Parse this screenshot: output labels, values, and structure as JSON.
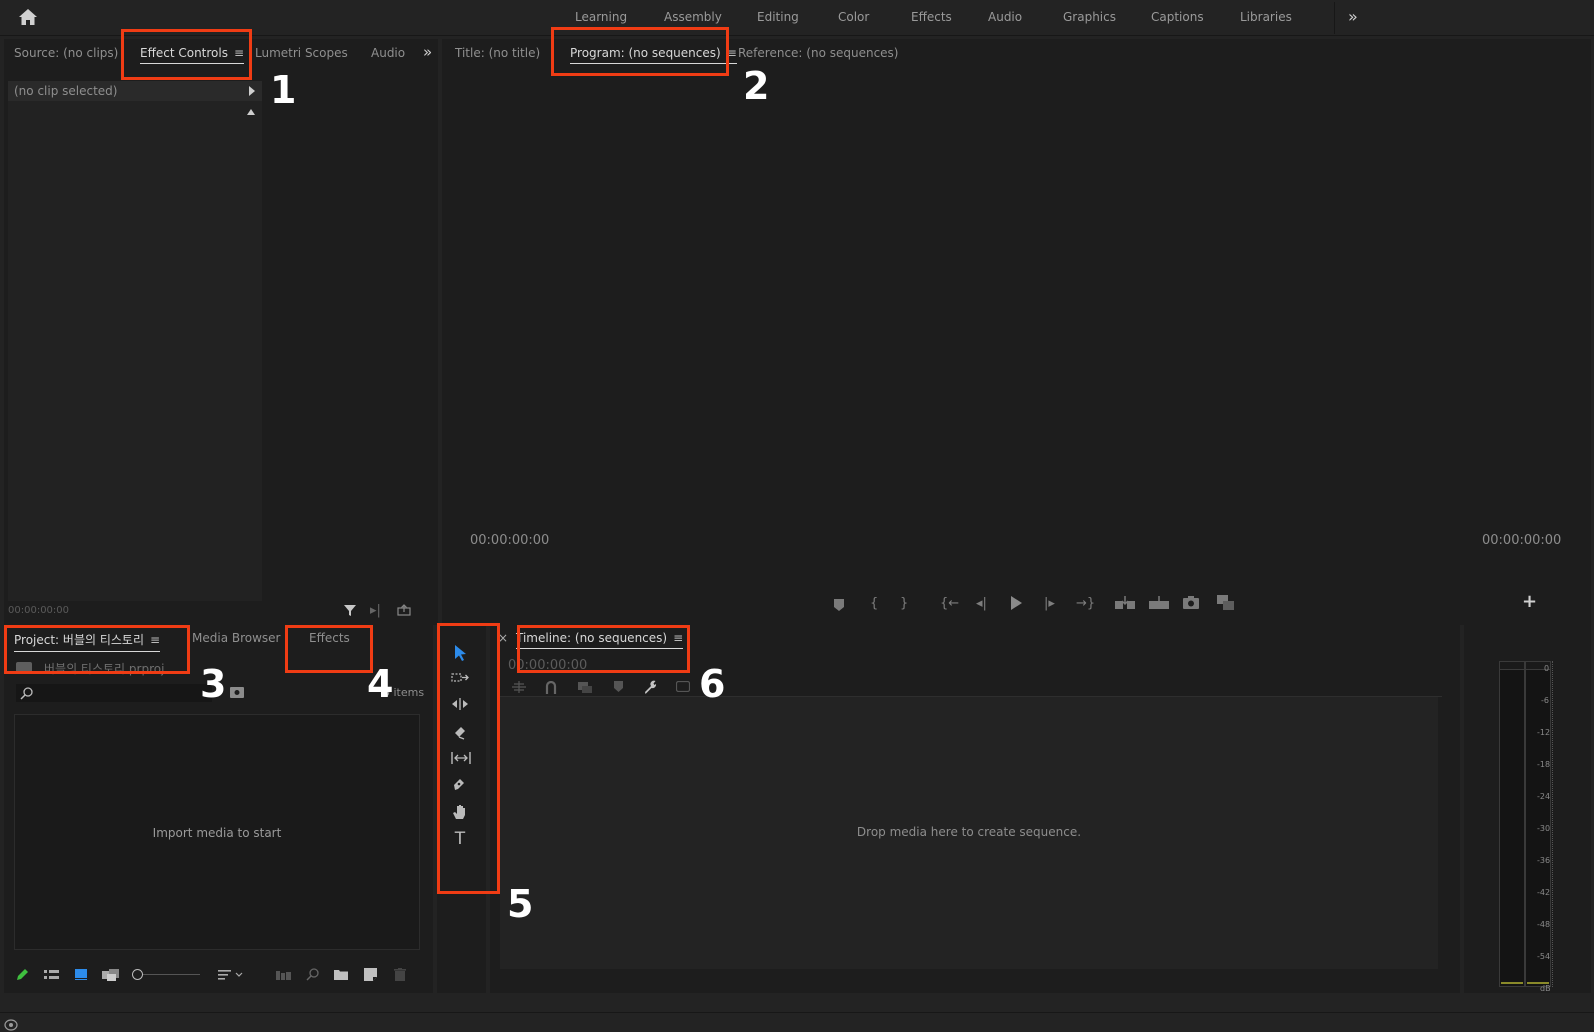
{
  "workspaces": {
    "home_icon": "home-icon",
    "items": [
      "Learning",
      "Assembly",
      "Editing",
      "Color",
      "Effects",
      "Audio",
      "Graphics",
      "Captions",
      "Libraries"
    ],
    "overflow_icon": "»"
  },
  "source_panel": {
    "tabs": {
      "source": "Source: (no clips)",
      "effect_controls": "Effect Controls",
      "lumetri": "Lumetri Scopes",
      "audio": "Audio",
      "overflow": "»"
    },
    "hamburger": "≡",
    "clip_header": "(no clip selected)",
    "timecode": "00:00:00:00"
  },
  "program_panel": {
    "tabs": {
      "title": "Title: (no title)",
      "program": "Program: (no sequences)",
      "reference": "Reference: (no sequences)"
    },
    "hamburger": "≡",
    "timecode_left": "00:00:00:00",
    "timecode_right": "00:00:00:00",
    "add_button": "+"
  },
  "project_panel": {
    "tabs": {
      "project": "Project: 버블의 티스토리",
      "media_browser": "Media Browser",
      "effects": "Effects"
    },
    "hamburger": "≡",
    "file_name": "버블의 티스토리.prproj",
    "item_count": "0 items",
    "search_placeholder": "",
    "empty_message": "Import media to start"
  },
  "tools": {
    "selection": "▶",
    "track_select": "⇢",
    "ripple": "↔",
    "razor": "◆",
    "slip": "|↔|",
    "pen": "✎",
    "hand": "✋",
    "type": "T"
  },
  "timeline_panel": {
    "close": "×",
    "tab": "Timeline: (no sequences)",
    "hamburger": "≡",
    "timecode": "00:00:00:00",
    "empty_message": "Drop media here to create sequence."
  },
  "audio_meter": {
    "labels": [
      "0",
      "-6",
      "-12",
      "-18",
      "-24",
      "-30",
      "-36",
      "-42",
      "-48",
      "-54",
      "dB"
    ]
  },
  "callouts": [
    "1",
    "2",
    "3",
    "4",
    "5",
    "6"
  ],
  "colors": {
    "highlight": "#f03c14",
    "panel": "#1d1d1d",
    "frame": "#232323",
    "selected_tool": "#2d8ceb"
  }
}
